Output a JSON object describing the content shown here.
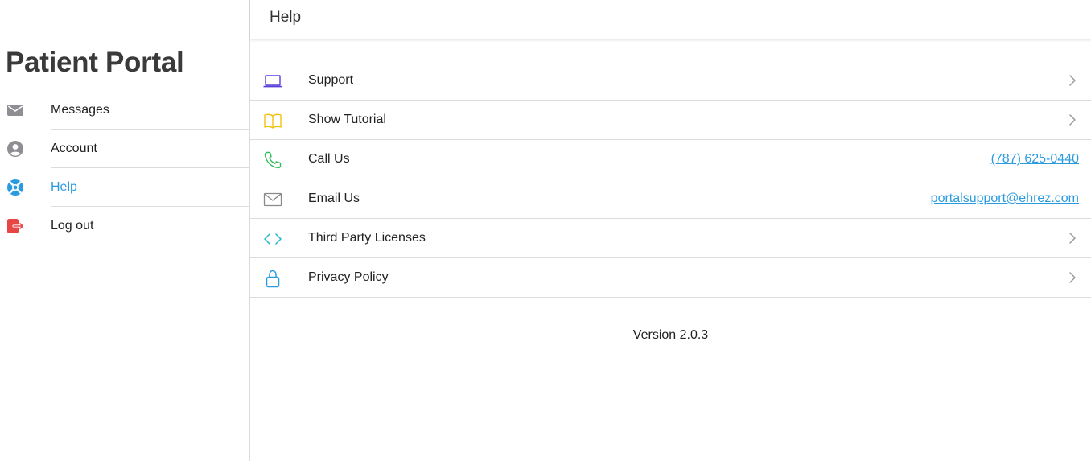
{
  "sidebar": {
    "brand": "Patient Portal",
    "items": [
      {
        "label": "Messages",
        "icon": "envelope-icon",
        "active": false
      },
      {
        "label": "Account",
        "icon": "user-circle-icon",
        "active": false
      },
      {
        "label": "Help",
        "icon": "lifebuoy-icon",
        "active": true
      },
      {
        "label": "Log out",
        "icon": "logout-icon",
        "active": false
      }
    ]
  },
  "header": {
    "title": "Help"
  },
  "help": {
    "rows": [
      {
        "label": "Support",
        "icon": "laptop-icon",
        "icon_color": "#5b3fd6",
        "trailing": "chevron"
      },
      {
        "label": "Show Tutorial",
        "icon": "book-icon",
        "icon_color": "#f2c10f",
        "trailing": "chevron"
      },
      {
        "label": "Call Us",
        "icon": "phone-icon",
        "icon_color": "#2ebd59",
        "trailing": "link",
        "link_text": "(787) 625-0440"
      },
      {
        "label": "Email Us",
        "icon": "envelope-outline-icon",
        "icon_color": "#8a8a8a",
        "trailing": "link",
        "link_text": "portalsupport@ehrez.com"
      },
      {
        "label": "Third Party Licenses",
        "icon": "code-icon",
        "icon_color": "#22b8cf",
        "trailing": "chevron"
      },
      {
        "label": "Privacy Policy",
        "icon": "lock-icon",
        "icon_color": "#2b9be0",
        "trailing": "chevron"
      }
    ],
    "version": "Version 2.0.3"
  },
  "colors": {
    "accent": "#2b9be0",
    "logout": "#e84545",
    "nav_icon": "#8e8e93",
    "divider": "#dcdcdc"
  }
}
